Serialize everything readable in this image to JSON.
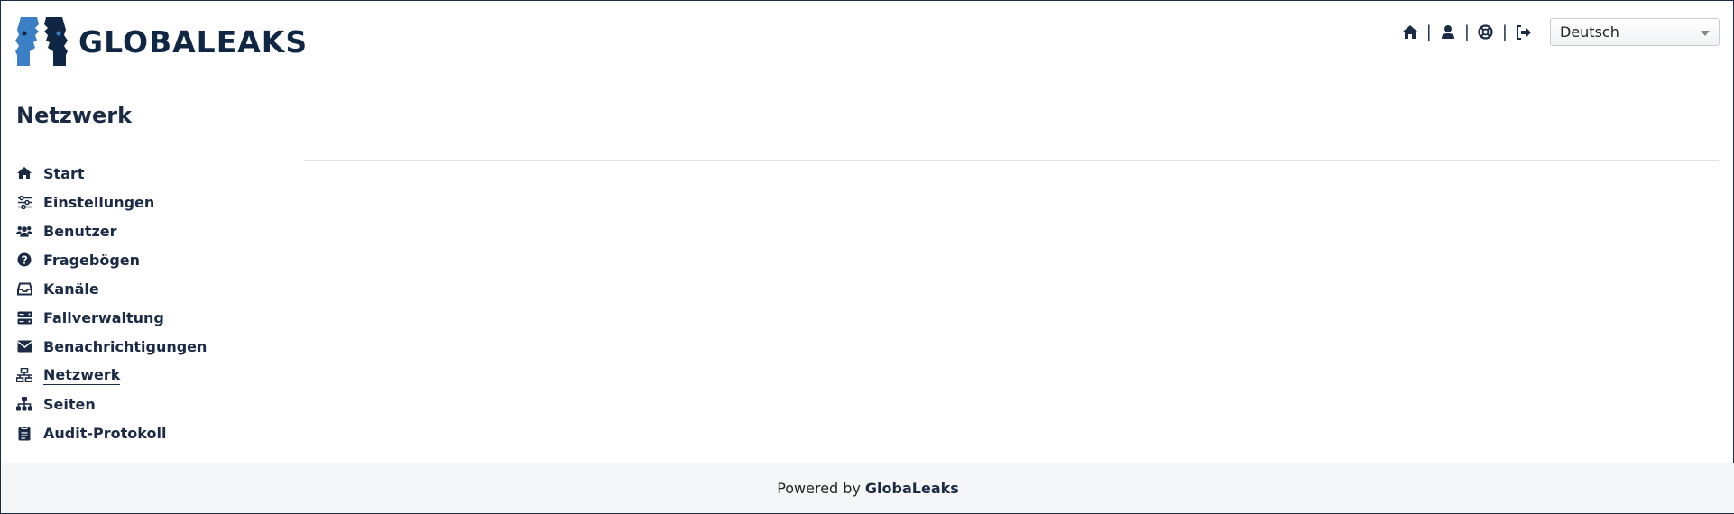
{
  "header": {
    "logo_text": "GLOBALEAKS",
    "icons": [
      "home-icon",
      "user-icon",
      "lifebuoy-icon",
      "logout-icon"
    ],
    "separator": "|",
    "language_selected": "Deutsch"
  },
  "page": {
    "title": "Netzwerk"
  },
  "sidebar": {
    "items": [
      {
        "label": "Start",
        "icon": "home-icon"
      },
      {
        "label": "Einstellungen",
        "icon": "sliders-icon"
      },
      {
        "label": "Benutzer",
        "icon": "users-icon"
      },
      {
        "label": "Fragebögen",
        "icon": "question-circle-icon"
      },
      {
        "label": "Kanäle",
        "icon": "inbox-icon"
      },
      {
        "label": "Fallverwaltung",
        "icon": "server-icon"
      },
      {
        "label": "Benachrichtigungen",
        "icon": "envelope-icon"
      },
      {
        "label": "Netzwerk",
        "icon": "network-icon",
        "active": true
      },
      {
        "label": "Seiten",
        "icon": "sitemap-icon"
      },
      {
        "label": "Audit-Protokoll",
        "icon": "clipboard-icon"
      }
    ]
  },
  "footer": {
    "prefix": "Powered by",
    "brand": "GlobaLeaks"
  },
  "colors": {
    "primary": "#1b2b45",
    "logo_blue": "#3b7fc4",
    "footer_bg": "#f5f6f8"
  }
}
